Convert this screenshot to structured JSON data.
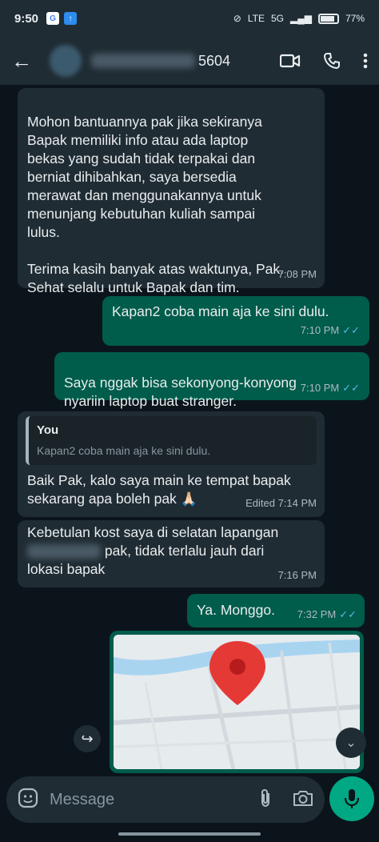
{
  "status_bar": {
    "time": "9:50",
    "battery": "77%",
    "net": "5G",
    "lte": "LTE"
  },
  "header": {
    "contact_visible": "5604"
  },
  "messages": [
    {
      "text": "Mohon bantuannya pak jika sekiranya\nBapak memiliki info atau ada laptop\nbekas yang sudah tidak terpakai dan\nberniat dihibahkan, saya bersedia\nmerawat dan menggunakannya untuk\nmenunjang kebutuhan kuliah sampai\nlulus.\n\nTerima kasih banyak atas waktunya, Pak.\nSehat selalu untuk Bapak dan tim.",
      "time": "7:08 PM"
    },
    {
      "text": "Kapan2 coba main aja ke sini dulu.",
      "time": "7:10 PM"
    },
    {
      "text": "Saya nggak bisa sekonyong-konyong\nnyariin laptop buat stranger.",
      "time": "7:10 PM"
    },
    {
      "quote_author": "You",
      "quote_text": "Kapan2 coba main aja ke sini dulu.",
      "text": "Baik Pak, kalo saya main ke tempat bapak\nsekarang apa boleh pak",
      "emoji": "🙏🏻",
      "time": "Edited 7:14 PM"
    },
    {
      "line1": "Kebetulan kost saya di selatan lapangan",
      "line2_tail": " pak, tidak terlalu jauh dari",
      "line3": "lokasi bapak",
      "time": "7:16 PM"
    },
    {
      "text": "Ya. Monggo.",
      "time": "7:32 PM"
    }
  ],
  "input": {
    "placeholder": "Message"
  },
  "colors": {
    "incoming": "#202c33",
    "outgoing": "#005c4b",
    "accent": "#00a884",
    "ticks": "#53bdeb"
  }
}
